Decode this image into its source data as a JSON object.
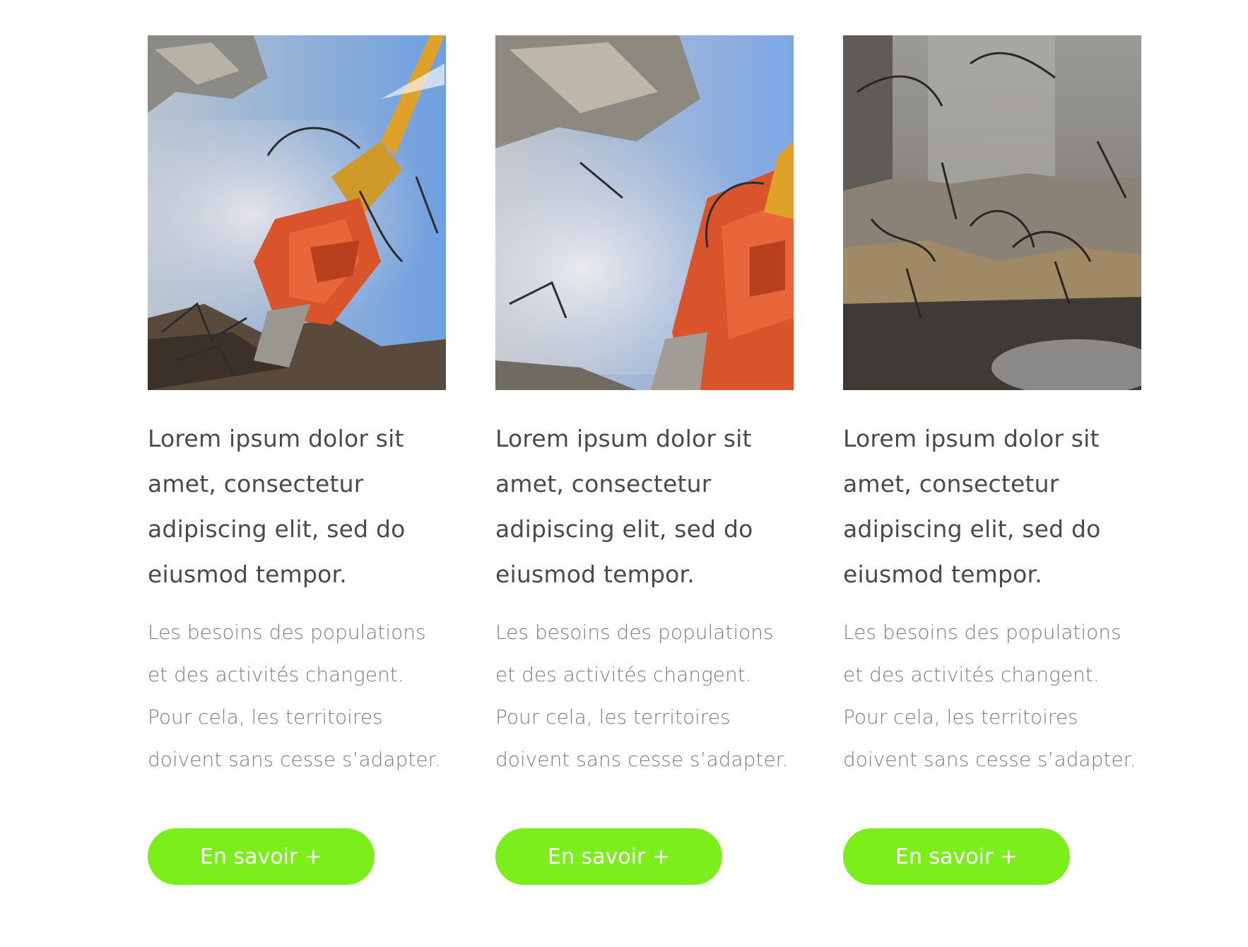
{
  "theme": {
    "button_color": "#7bee1c",
    "headline_color": "#4a4a4a",
    "body_color": "#7b7b85"
  },
  "cards": [
    {
      "image": "demolition-excavator-photo",
      "headline": "Lorem ipsum dolor sit amet, consectetur adipiscing elit, sed do eiusmod tempor.",
      "description": "Les besoins des populations et des activités changent. Pour cela, les territoires doivent sans cesse s’adapter.",
      "button_label": "En savoir +"
    },
    {
      "image": "demolition-excavator-closeup-photo",
      "headline": "Lorem ipsum dolor sit amet, consectetur adipiscing elit, sed do eiusmod tempor.",
      "description": "Les besoins des populations et des activités changent. Pour cela, les territoires doivent sans cesse s’adapter.",
      "button_label": "En savoir +"
    },
    {
      "image": "concrete-rebar-debris-photo",
      "headline": "Lorem ipsum dolor sit amet, consectetur adipiscing elit, sed do eiusmod tempor.",
      "description": "Les besoins des populations et des activités changent. Pour cela, les territoires doivent sans cesse s’adapter.",
      "button_label": "En savoir +"
    }
  ]
}
